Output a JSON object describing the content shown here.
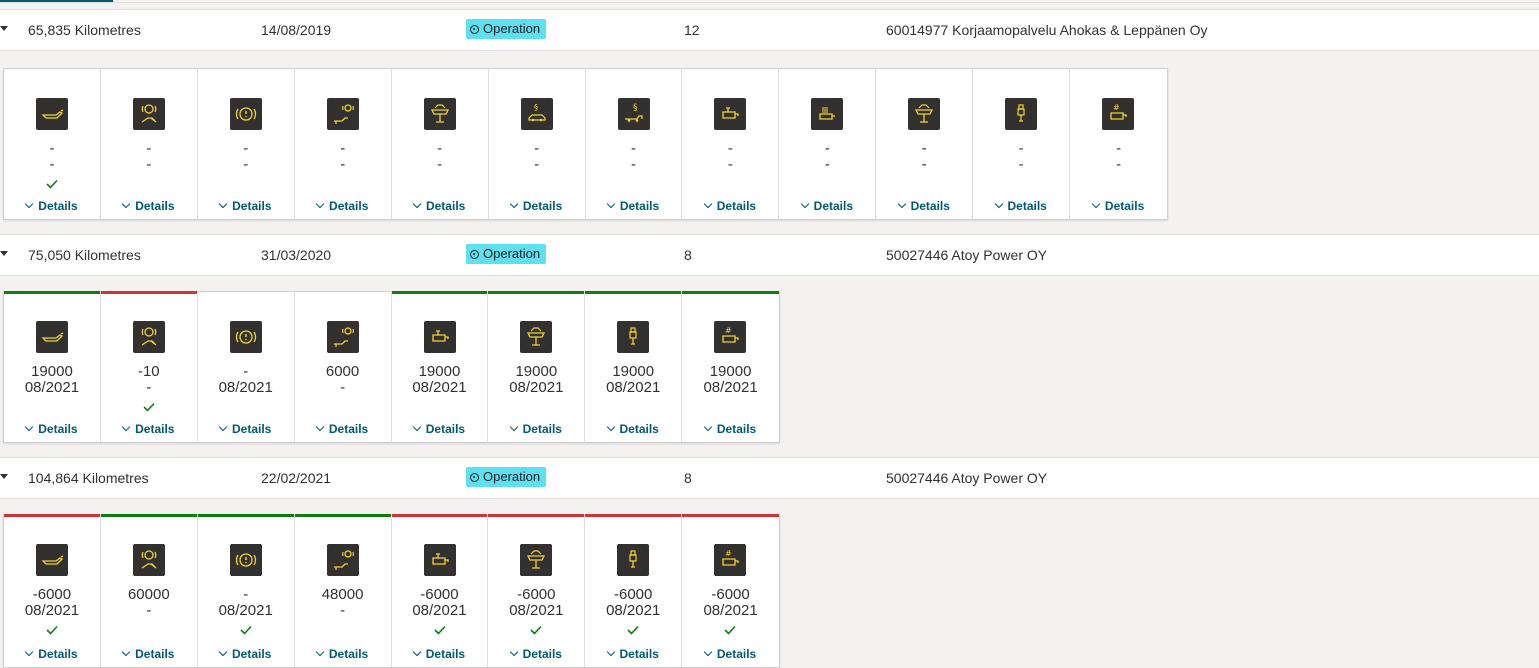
{
  "colors": {
    "ok": "#107c10",
    "warn": "#d13438",
    "accent": "#005a70",
    "badge": "#5ee0f0"
  },
  "details_label": "Details",
  "records": [
    {
      "distance": "65,835 Kilometres",
      "date": "14/08/2019",
      "type": "Operation",
      "count": "12",
      "workshop": "60014977 Korjaamopalvelu Ahokas & Leppänen Oy",
      "cards": [
        {
          "icon": "oil-can-icon",
          "v1": "-",
          "v2": "-",
          "check": true,
          "status": "none"
        },
        {
          "icon": "brake-service-icon",
          "v1": "-",
          "v2": "-",
          "check": false,
          "status": "none"
        },
        {
          "icon": "brake-warning-icon",
          "v1": "-",
          "v2": "-",
          "check": false,
          "status": "none"
        },
        {
          "icon": "brake-fluid-icon",
          "v1": "-",
          "v2": "-",
          "check": false,
          "status": "none"
        },
        {
          "icon": "hydraulic-lift-icon",
          "v1": "-",
          "v2": "-",
          "check": false,
          "status": "none"
        },
        {
          "icon": "inspection-vehicle-icon",
          "v1": "-",
          "v2": "-",
          "check": false,
          "status": "none"
        },
        {
          "icon": "inspection-trailer-icon",
          "v1": "-",
          "v2": "-",
          "check": false,
          "status": "none"
        },
        {
          "icon": "fuel-filter-icon",
          "v1": "-",
          "v2": "-",
          "check": false,
          "status": "none"
        },
        {
          "icon": "air-filter-icon",
          "v1": "-",
          "v2": "-",
          "check": false,
          "status": "none"
        },
        {
          "icon": "hydraulic-lift-icon",
          "v1": "-",
          "v2": "-",
          "check": false,
          "status": "none"
        },
        {
          "icon": "spark-plug-icon",
          "v1": "-",
          "v2": "-",
          "check": false,
          "status": "none"
        },
        {
          "icon": "filter-hash-icon",
          "v1": "-",
          "v2": "-",
          "check": false,
          "status": "none"
        }
      ]
    },
    {
      "distance": "75,050 Kilometres",
      "date": "31/03/2020",
      "type": "Operation",
      "count": "8",
      "workshop": "50027446 Atoy Power OY",
      "cards": [
        {
          "icon": "oil-can-icon",
          "v1": "19000",
          "v2": "08/2021",
          "check": false,
          "status": "ok"
        },
        {
          "icon": "brake-service-icon",
          "v1": "-10",
          "v2": "-",
          "check": true,
          "status": "warn"
        },
        {
          "icon": "brake-warning-icon",
          "v1": "-",
          "v2": "08/2021",
          "check": false,
          "status": "none"
        },
        {
          "icon": "brake-fluid-icon",
          "v1": "6000",
          "v2": "-",
          "check": false,
          "status": "none"
        },
        {
          "icon": "fuel-filter-icon",
          "v1": "19000",
          "v2": "08/2021",
          "check": false,
          "status": "ok"
        },
        {
          "icon": "hydraulic-lift-icon",
          "v1": "19000",
          "v2": "08/2021",
          "check": false,
          "status": "ok"
        },
        {
          "icon": "spark-plug-icon",
          "v1": "19000",
          "v2": "08/2021",
          "check": false,
          "status": "ok"
        },
        {
          "icon": "filter-hash-icon",
          "v1": "19000",
          "v2": "08/2021",
          "check": false,
          "status": "ok"
        }
      ]
    },
    {
      "distance": "104,864 Kilometres",
      "date": "22/02/2021",
      "type": "Operation",
      "count": "8",
      "workshop": "50027446 Atoy Power OY",
      "cards": [
        {
          "icon": "oil-can-icon",
          "v1": "-6000",
          "v2": "08/2021",
          "check": true,
          "status": "warn"
        },
        {
          "icon": "brake-service-icon",
          "v1": "60000",
          "v2": "-",
          "check": false,
          "status": "ok"
        },
        {
          "icon": "brake-warning-icon",
          "v1": "-",
          "v2": "08/2021",
          "check": true,
          "status": "ok"
        },
        {
          "icon": "brake-fluid-icon",
          "v1": "48000",
          "v2": "-",
          "check": false,
          "status": "ok"
        },
        {
          "icon": "fuel-filter-icon",
          "v1": "-6000",
          "v2": "08/2021",
          "check": true,
          "status": "warn"
        },
        {
          "icon": "hydraulic-lift-icon",
          "v1": "-6000",
          "v2": "08/2021",
          "check": true,
          "status": "warn"
        },
        {
          "icon": "spark-plug-icon",
          "v1": "-6000",
          "v2": "08/2021",
          "check": true,
          "status": "warn"
        },
        {
          "icon": "filter-hash-icon",
          "v1": "-6000",
          "v2": "08/2021",
          "check": true,
          "status": "warn"
        }
      ]
    }
  ]
}
